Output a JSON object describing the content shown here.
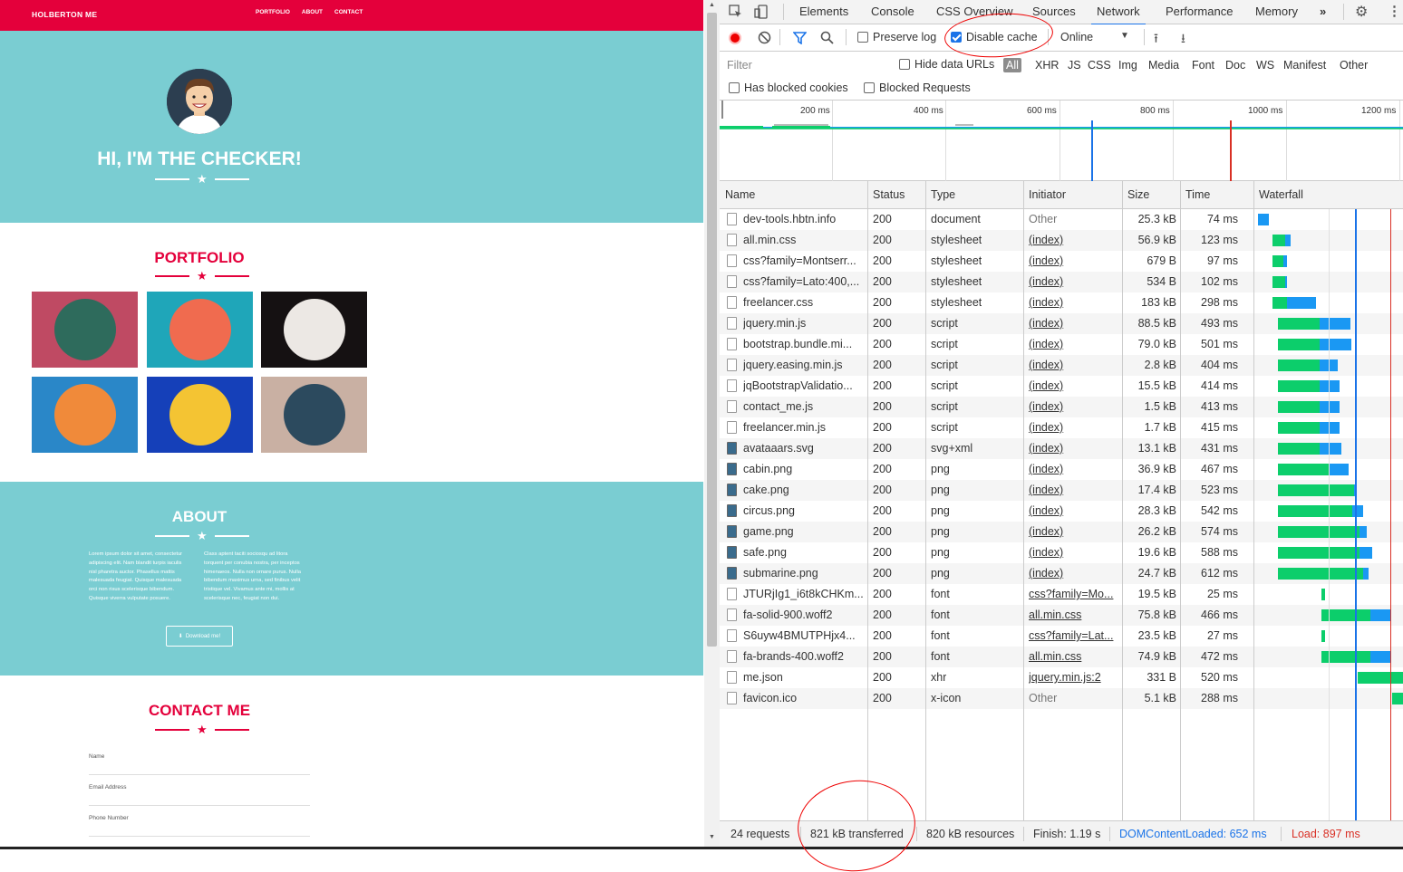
{
  "site": {
    "brand": "HOLBERTON ME",
    "nav": [
      "PORTFOLIO",
      "ABOUT",
      "CONTACT"
    ],
    "hero_title": "HI, I'M THE CHECKER!",
    "portfolio_title": "PORTFOLIO",
    "portfolio_tiles": [
      {
        "name": "cabin",
        "bg": "#bf4a63"
      },
      {
        "name": "cake",
        "bg": "#1fa6b9"
      },
      {
        "name": "circus",
        "bg": "#151112"
      },
      {
        "name": "game",
        "bg": "#2a87c8"
      },
      {
        "name": "safe",
        "bg": "#1540b9"
      },
      {
        "name": "submarine",
        "bg": "#c9b0a3"
      }
    ],
    "about_title": "ABOUT",
    "about_left": "Lorem ipsum dolor sit amet, consectetur adipiscing elit. Nam blandit turpis iaculis nisl pharetra auctor. Phasellus mattis malesuada feugiat. Quisque malesuada orci non risus scelerisque bibendum. Quisque viverra vulputate posuere.",
    "about_right": "Class aptent taciti sociosqu ad litora torquent per conubia nostra, per inceptos himenaeos. Nulla non ornare purus. Nulla bibendum maximus urna, sed finibus velit tristique vel. Vivamus ante mi, mollis at scelerisque nec, feugiat non dui.",
    "download_label": "Download me!",
    "contact_title": "CONTACT ME",
    "contact_fields": [
      "Name",
      "Email Address",
      "Phone Number"
    ]
  },
  "devtools": {
    "tabs": [
      "Elements",
      "Console",
      "CSS Overview",
      "Sources",
      "Network",
      "Performance",
      "Memory"
    ],
    "active_tab": "Network",
    "more_tabs": "»",
    "preserve_log": "Preserve log",
    "disable_cache": "Disable cache",
    "throttle": "Online",
    "filter_placeholder": "Filter",
    "hide_data_urls": "Hide data URLs",
    "type_filters": [
      "All",
      "XHR",
      "JS",
      "CSS",
      "Img",
      "Media",
      "Font",
      "Doc",
      "WS",
      "Manifest",
      "Other"
    ],
    "has_blocked_cookies": "Has blocked cookies",
    "blocked_requests": "Blocked Requests",
    "timeline_ticks": [
      "200 ms",
      "400 ms",
      "600 ms",
      "800 ms",
      "1000 ms",
      "1200 ms"
    ],
    "columns": [
      "Name",
      "Status",
      "Type",
      "Initiator",
      "Size",
      "Time",
      "Waterfall"
    ],
    "rows": [
      {
        "name": "dev-tools.hbtn.info",
        "status": "200",
        "type": "document",
        "initiator": "Other",
        "size": "25.3 kB",
        "time": "74 ms",
        "icon": "doc",
        "start": 0,
        "wait": 0.0,
        "dl": 12
      },
      {
        "name": "all.min.css",
        "status": "200",
        "type": "stylesheet",
        "initiator": "(index)",
        "size": "56.9 kB",
        "time": "123 ms",
        "icon": "doc",
        "start": 16,
        "wait": 14,
        "dl": 6
      },
      {
        "name": "css?family=Montserr...",
        "status": "200",
        "type": "stylesheet",
        "initiator": "(index)",
        "size": "679 B",
        "time": "97 ms",
        "icon": "doc",
        "start": 16,
        "wait": 12,
        "dl": 4
      },
      {
        "name": "css?family=Lato:400,...",
        "status": "200",
        "type": "stylesheet",
        "initiator": "(index)",
        "size": "534 B",
        "time": "102 ms",
        "icon": "doc",
        "start": 16,
        "wait": 14,
        "dl": 2
      },
      {
        "name": "freelancer.css",
        "status": "200",
        "type": "stylesheet",
        "initiator": "(index)",
        "size": "183 kB",
        "time": "298 ms",
        "icon": "doc",
        "start": 16,
        "wait": 16,
        "dl": 32
      },
      {
        "name": "jquery.min.js",
        "status": "200",
        "type": "script",
        "initiator": "(index)",
        "size": "88.5 kB",
        "time": "493 ms",
        "icon": "doc",
        "start": 22,
        "wait": 46,
        "dl": 34
      },
      {
        "name": "bootstrap.bundle.mi...",
        "status": "200",
        "type": "script",
        "initiator": "(index)",
        "size": "79.0 kB",
        "time": "501 ms",
        "icon": "doc",
        "start": 22,
        "wait": 46,
        "dl": 35
      },
      {
        "name": "jquery.easing.min.js",
        "status": "200",
        "type": "script",
        "initiator": "(index)",
        "size": "2.8 kB",
        "time": "404 ms",
        "icon": "doc",
        "start": 22,
        "wait": 46,
        "dl": 20
      },
      {
        "name": "jqBootstrapValidatio...",
        "status": "200",
        "type": "script",
        "initiator": "(index)",
        "size": "15.5 kB",
        "time": "414 ms",
        "icon": "doc",
        "start": 22,
        "wait": 46,
        "dl": 22
      },
      {
        "name": "contact_me.js",
        "status": "200",
        "type": "script",
        "initiator": "(index)",
        "size": "1.5 kB",
        "time": "413 ms",
        "icon": "doc",
        "start": 22,
        "wait": 46,
        "dl": 22
      },
      {
        "name": "freelancer.min.js",
        "status": "200",
        "type": "script",
        "initiator": "(index)",
        "size": "1.7 kB",
        "time": "415 ms",
        "icon": "doc",
        "start": 22,
        "wait": 46,
        "dl": 22
      },
      {
        "name": "avataaars.svg",
        "status": "200",
        "type": "svg+xml",
        "initiator": "(index)",
        "size": "13.1 kB",
        "time": "431 ms",
        "icon": "img",
        "start": 22,
        "wait": 46,
        "dl": 24
      },
      {
        "name": "cabin.png",
        "status": "200",
        "type": "png",
        "initiator": "(index)",
        "size": "36.9 kB",
        "time": "467 ms",
        "icon": "img",
        "start": 22,
        "wait": 56,
        "dl": 22
      },
      {
        "name": "cake.png",
        "status": "200",
        "type": "png",
        "initiator": "(index)",
        "size": "17.4 kB",
        "time": "523 ms",
        "icon": "img",
        "start": 22,
        "wait": 84,
        "dl": 2
      },
      {
        "name": "circus.png",
        "status": "200",
        "type": "png",
        "initiator": "(index)",
        "size": "28.3 kB",
        "time": "542 ms",
        "icon": "img",
        "start": 22,
        "wait": 82,
        "dl": 12
      },
      {
        "name": "game.png",
        "status": "200",
        "type": "png",
        "initiator": "(index)",
        "size": "26.2 kB",
        "time": "574 ms",
        "icon": "img",
        "start": 22,
        "wait": 90,
        "dl": 8
      },
      {
        "name": "safe.png",
        "status": "200",
        "type": "png",
        "initiator": "(index)",
        "size": "19.6 kB",
        "time": "588 ms",
        "icon": "img",
        "start": 22,
        "wait": 90,
        "dl": 14
      },
      {
        "name": "submarine.png",
        "status": "200",
        "type": "png",
        "initiator": "(index)",
        "size": "24.7 kB",
        "time": "612 ms",
        "icon": "img",
        "start": 22,
        "wait": 94,
        "dl": 6
      },
      {
        "name": "JTURjIg1_i6t8kCHKm...",
        "status": "200",
        "type": "font",
        "initiator": "css?family=Mo...",
        "size": "19.5 kB",
        "time": "25 ms",
        "icon": "doc",
        "start": 70,
        "wait": 4,
        "dl": 0
      },
      {
        "name": "fa-solid-900.woff2",
        "status": "200",
        "type": "font",
        "initiator": "all.min.css",
        "size": "75.8 kB",
        "time": "466 ms",
        "icon": "doc",
        "start": 70,
        "wait": 54,
        "dl": 22
      },
      {
        "name": "S6uyw4BMUTPHjx4...",
        "status": "200",
        "type": "font",
        "initiator": "css?family=Lat...",
        "size": "23.5 kB",
        "time": "27 ms",
        "icon": "doc",
        "start": 70,
        "wait": 4,
        "dl": 0
      },
      {
        "name": "fa-brands-400.woff2",
        "status": "200",
        "type": "font",
        "initiator": "all.min.css",
        "size": "74.9 kB",
        "time": "472 ms",
        "icon": "doc",
        "start": 70,
        "wait": 54,
        "dl": 22
      },
      {
        "name": "me.json",
        "status": "200",
        "type": "xhr",
        "initiator": "jquery.min.js:2",
        "size": "331 B",
        "time": "520 ms",
        "icon": "doc",
        "start": 110,
        "wait": 50,
        "dl": 0
      },
      {
        "name": "favicon.ico",
        "status": "200",
        "type": "x-icon",
        "initiator": "Other",
        "size": "5.1 kB",
        "time": "288 ms",
        "icon": "doc",
        "start": 148,
        "wait": 12,
        "dl": 0
      }
    ],
    "summary": {
      "requests": "24 requests",
      "transferred": "821 kB transferred",
      "resources": "820 kB resources",
      "finish": "Finish: 1.19 s",
      "dcl": "DOMContentLoaded: 652 ms",
      "load": "Load: 897 ms"
    },
    "colors": {
      "green": "#0cce6b",
      "blue": "#1a98f3",
      "dcl": "#1a73e8",
      "load": "#d93025"
    }
  }
}
